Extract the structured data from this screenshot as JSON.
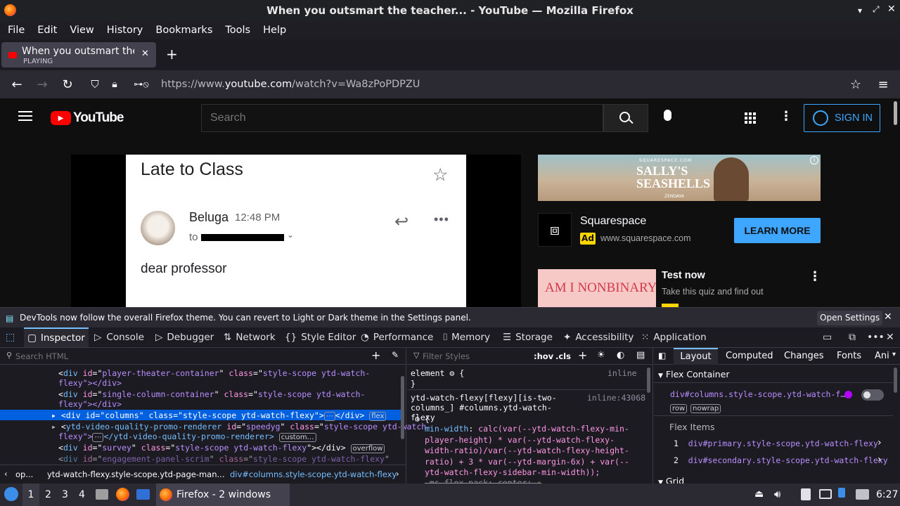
{
  "window": {
    "title": "When you outsmart the teacher... - YouTube — Mozilla Firefox"
  },
  "menu": [
    "File",
    "Edit",
    "View",
    "History",
    "Bookmarks",
    "Tools",
    "Help"
  ],
  "tab": {
    "title": "When you outsmart the t",
    "status": "PLAYING"
  },
  "url": {
    "prefix": "https://www.",
    "domain": "youtube.com",
    "path": "/watch?v=Wa8zPoPDPZU"
  },
  "youtube": {
    "logo_text": "YouTube",
    "search_placeholder": "Search",
    "sign_in": "SIGN IN",
    "video": {
      "subject": "Late to Class",
      "sender": "Beluga",
      "time": "12:48 PM",
      "to_label": "to",
      "body": "dear professor"
    },
    "ad": {
      "banner_title": "SALLY'S SEASHELLS",
      "banner_brand": "SQUARESPACE.COM",
      "banner_sub": "ZENDAYA",
      "advertiser": "Squarespace",
      "ad_badge": "Ad",
      "ad_url": "www.squarespace.com",
      "cta": "LEARN MORE"
    },
    "suggested": {
      "thumb_text": "AM I NONBINARY?",
      "title": "Test now",
      "subtitle": "Take this quiz and find out"
    }
  },
  "devtools": {
    "notice": "DevTools now follow the overall Firefox theme. You can revert to Light or Dark theme in the Settings panel.",
    "open_settings": "Open Settings",
    "tabs": [
      "Inspector",
      "Console",
      "Debugger",
      "Network",
      "Style Editor",
      "Performance",
      "Memory",
      "Storage",
      "Accessibility",
      "Application"
    ],
    "search_html": "Search HTML",
    "filter_styles": "Filter Styles",
    "hov": ":hov",
    "cls": ".cls",
    "html_lines": [
      {
        "tag": "div",
        "id": "player-theater-container",
        "cls": "style-scope ytd-watch-",
        "cont": "flexy\"></div>"
      },
      {
        "tag": "div",
        "id": "single-column-container",
        "cls": "style-scope ytd-watch-",
        "cont": "flexy\"></div>"
      },
      {
        "tag": "div",
        "id": "columns",
        "cls": "style-scope ytd-watch-flexy",
        "badge": "flex"
      },
      {
        "tag": "ytd-video-quality-promo-renderer",
        "id": "speedyg",
        "cls": "style-scope ytd-watch-",
        "cont": "flexy\">",
        "tail": "</ytd-video-quality-promo-renderer>",
        "badge": "custom…"
      },
      {
        "tag": "div",
        "id": "survey",
        "cls": "style-scope ytd-watch-flexy",
        "badge": "overflow"
      },
      {
        "tag": "div",
        "id": "engagement-panel-scrim",
        "cls": "style-scope ytd-watch-flexy"
      }
    ],
    "breadcrumbs": [
      "op...",
      "ytd-watch-flexy.style-scope.ytd-page-man...",
      "div#columns.style-scope.ytd-watch-flexy"
    ],
    "rules": {
      "element_selector": "element",
      "element_source": "inline",
      "selector": "ytd-watch-flexy[flexy][is-two-columns_] #columns.ytd-watch-flexy",
      "source": "inline:43068",
      "prop": "min-width",
      "value": "calc(var(--ytd-watch-flexy-min-player-height) * var(--ytd-watch-flexy-width-ratio)/var(--ytd-watch-flexy-height-ratio) + 3 * var(--ytd-margin-6x) + var(--ytd-watch-flexy-sidebar-min-width));",
      "next_prop": "-ms-flex-pack: center;"
    },
    "layout_tabs": [
      "Layout",
      "Computed",
      "Changes",
      "Fonts",
      "Ani"
    ],
    "flex_container": "Flex Container",
    "flex_container_el": "div#columns.style-scope.ytd-watch-f…",
    "flex_badges": [
      "row",
      "nowrap"
    ],
    "flex_items_label": "Flex Items",
    "flex_items": [
      {
        "n": "1",
        "sel": "div#primary.style-scope.ytd-watch-flexy"
      },
      {
        "n": "2",
        "sel": "div#secondary.style-scope.ytd-watch-flexy"
      }
    ],
    "grid_label": "Grid"
  },
  "taskbar": {
    "workspaces": [
      "1",
      "2",
      "3",
      "4"
    ],
    "active_window": "Firefox - 2 windows",
    "clock": "6:27"
  }
}
